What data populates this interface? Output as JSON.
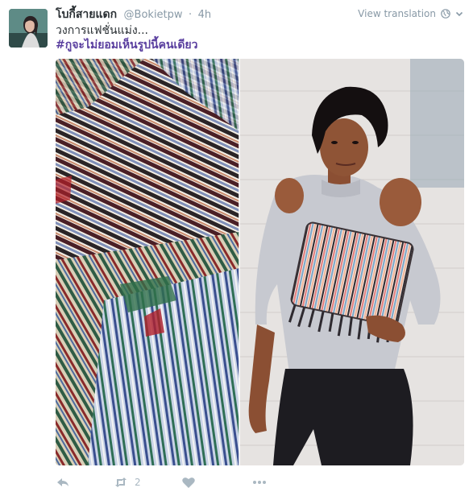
{
  "tweet": {
    "display_name": "โบกี้สายแดก",
    "username": "@Bokietpw",
    "separator": "·",
    "time": "4h",
    "translate_label": "View translation",
    "text_line1": "วงการแฟชั่นแม่ง...",
    "hashtag": "#กูจะไม่ยอมเห็นรูปนี้คนเดียว",
    "retweet_count": "2"
  },
  "icons": {
    "reply": "reply-icon",
    "retweet": "retweet-icon",
    "like": "heart-icon",
    "more": "more-icon",
    "globe": "globe-icon",
    "caret": "chevron-down-icon"
  },
  "colors": {
    "hashtag": "#5a3f9f",
    "muted": "#8899a6",
    "action": "#aab8c2"
  }
}
